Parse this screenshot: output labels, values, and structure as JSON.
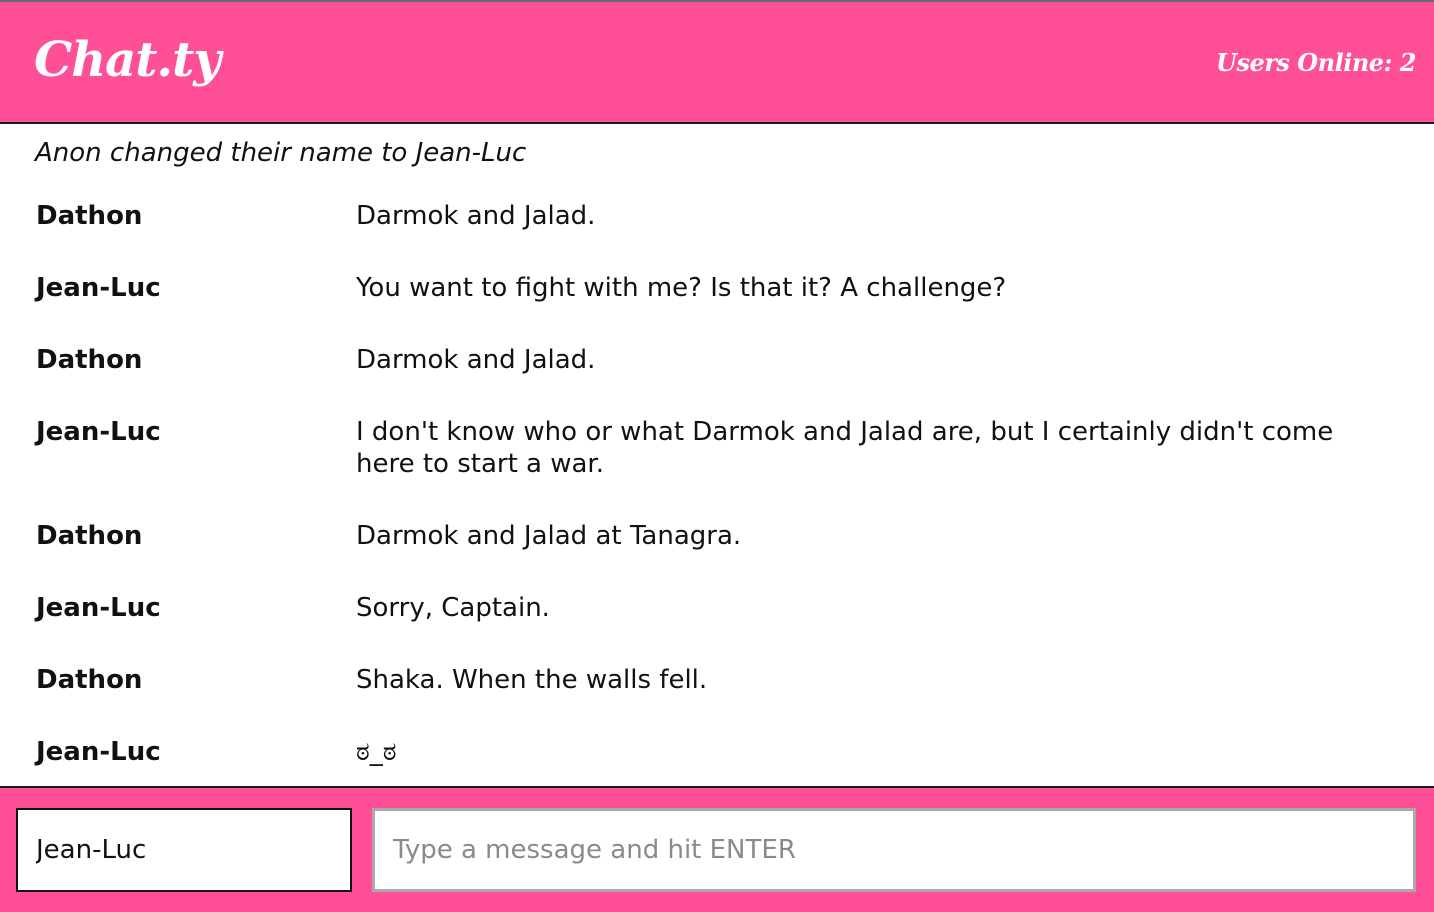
{
  "header": {
    "logo": "Chat.ty",
    "users_online": "Users Online: 2"
  },
  "messages": {
    "system_notice": "Anon changed their name to Jean-Luc",
    "items": [
      {
        "author": "Dathon",
        "text": "Darmok and Jalad."
      },
      {
        "author": "Jean-Luc",
        "text": "You want to fight with me? Is that it? A challenge?"
      },
      {
        "author": "Dathon",
        "text": "Darmok and Jalad."
      },
      {
        "author": "Jean-Luc",
        "text": "I don't know who or what Darmok and Jalad are, but I certainly didn't come here to start a war."
      },
      {
        "author": "Dathon",
        "text": "Darmok and Jalad at Tanagra."
      },
      {
        "author": "Jean-Luc",
        "text": "Sorry, Captain."
      },
      {
        "author": "Dathon",
        "text": "Shaka. When the walls fell."
      },
      {
        "author": "Jean-Luc",
        "text": "ಠ_ಠ"
      }
    ]
  },
  "footer": {
    "name_value": "Jean-Luc",
    "message_value": "",
    "message_placeholder": "Type a message and hit ENTER"
  },
  "colors": {
    "brand_pink": "#ff4f96",
    "text": "#111111",
    "placeholder": "#8a8a8a"
  }
}
